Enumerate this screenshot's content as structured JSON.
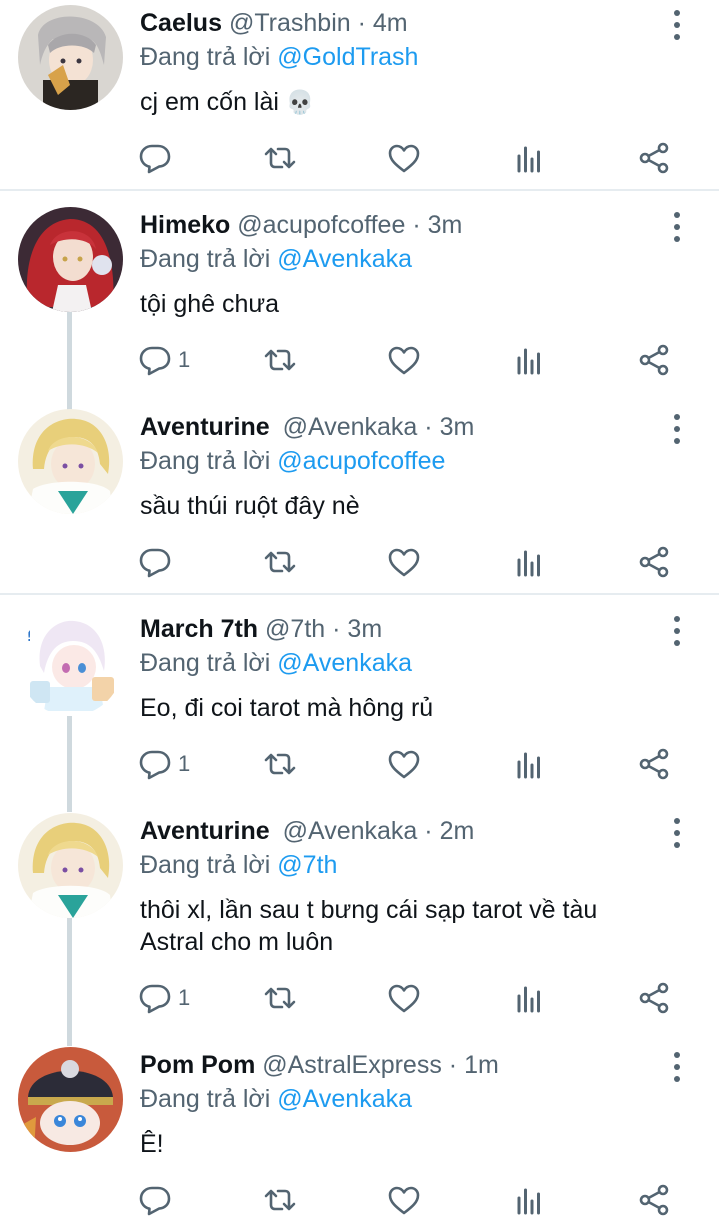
{
  "reply_prefix": "Đang trả lời",
  "tweets": [
    {
      "name": "Caelus",
      "handle": "@Trashbin",
      "dot": "·",
      "time": "4m",
      "reply_to": "@GoldTrash",
      "text": "cj em cốn lài",
      "emoji": "💀",
      "reply_count": ""
    },
    {
      "name": "Himeko",
      "handle": "@acupofcoffee",
      "dot": "·",
      "time": "3m",
      "reply_to": "@Avenkaka",
      "text": "tội ghê chưa",
      "reply_count": "1"
    },
    {
      "name": "Aventurine",
      "handle": "@Avenkaka",
      "dot": "·",
      "time": "3m",
      "reply_to": "@acupofcoffee",
      "text": "sầu thúi ruột đây nè",
      "reply_count": ""
    },
    {
      "name": "March 7th",
      "handle": "@7th",
      "dot": "·",
      "time": "3m",
      "reply_to": "@Avenkaka",
      "text": "Eo, đi coi tarot mà hông rủ",
      "reply_count": "1"
    },
    {
      "name": "Aventurine",
      "handle": "@Avenkaka",
      "dot": "·",
      "time": "2m",
      "reply_to": "@7th",
      "text_line1": "thôi xl, lần sau t bưng cái sạp tarot về tàu",
      "text_line2": "Astral cho m luôn",
      "reply_count": "1"
    },
    {
      "name": "Pom Pom",
      "handle": "@AstralExpress",
      "dot": "·",
      "time": "1m",
      "reply_to": "@Avenkaka",
      "text": "Ê!",
      "reply_count": ""
    }
  ],
  "icons": {
    "reply": "reply-icon",
    "retweet": "retweet-icon",
    "like": "like-icon",
    "views": "views-icon",
    "share": "share-icon",
    "more": "more-icon"
  },
  "colors": {
    "mention": "#1d9bf0",
    "secondary": "#536471",
    "divider": "#e6ecf0",
    "thread_line": "#cfd9de"
  }
}
